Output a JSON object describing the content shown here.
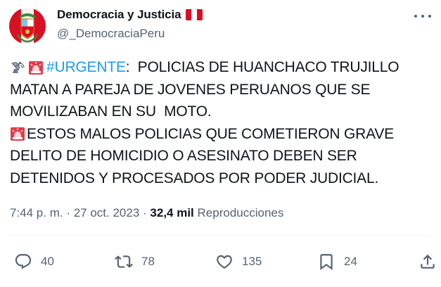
{
  "author": {
    "display_name": "Democracia y Justicia",
    "handle": "@_DemocraciaPeru",
    "flag_colors": [
      "#d91023",
      "#ffffff",
      "#d91023"
    ]
  },
  "tweet": {
    "lines": [
      {
        "icons": [
          "satellite-antenna-emoji",
          "rotating-light-emoji"
        ],
        "hashtag": "#URGENTE",
        "text": ":  POLICIAS DE HUANCHACO TRUJILLO"
      },
      {
        "text": "MATAN A PAREJA DE JOVENES PERUANOS QUE SE"
      },
      {
        "text": "MOVILIZABAN EN SU  MOTO."
      },
      {
        "icons": [
          "rotating-light-emoji"
        ],
        "text": "ESTOS MALOS POLICIAS QUE COMETIERON GRAVE"
      },
      {
        "text": "DELITO DE HOMICIDIO O ASESINATO DEBEN SER"
      },
      {
        "text": "DETENIDOS Y PROCESADOS POR PODER JUDICIAL."
      }
    ]
  },
  "meta": {
    "time": "7:44 p. m.",
    "separator": " · ",
    "date": "27 oct. 2023",
    "views_count": "32,4 mil",
    "views_label": "Reproducciones"
  },
  "actions": {
    "replies": "40",
    "reposts": "78",
    "likes": "135",
    "bookmarks": "24"
  },
  "colors": {
    "text": "#0f1419",
    "secondary": "#536471",
    "link": "#1d9bf0",
    "divider": "#eff3f4"
  }
}
